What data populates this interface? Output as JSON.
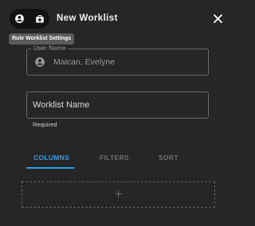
{
  "header": {
    "title": "New Worklist",
    "tooltip": "Role Worklist Settings",
    "toggle_icons": [
      "account-circle-icon",
      "medical-bag-icon"
    ],
    "close_icon": "close-icon"
  },
  "form": {
    "user": {
      "label": "User Name",
      "value": "Maican, Evelyne",
      "icon": "account-circle-icon"
    },
    "worklist_name": {
      "placeholder": "Worklist Name",
      "value": "",
      "helper": "Required"
    }
  },
  "tabs": [
    {
      "label": "COLUMNS",
      "active": true
    },
    {
      "label": "FILTERS",
      "active": false
    },
    {
      "label": "SORT",
      "active": false
    }
  ],
  "add_column": {
    "symbol": "+"
  },
  "colors": {
    "background": "#262626",
    "accent": "#2f9fe8",
    "toggle_background": "#121212",
    "tooltip_background": "#5b5b5b"
  }
}
